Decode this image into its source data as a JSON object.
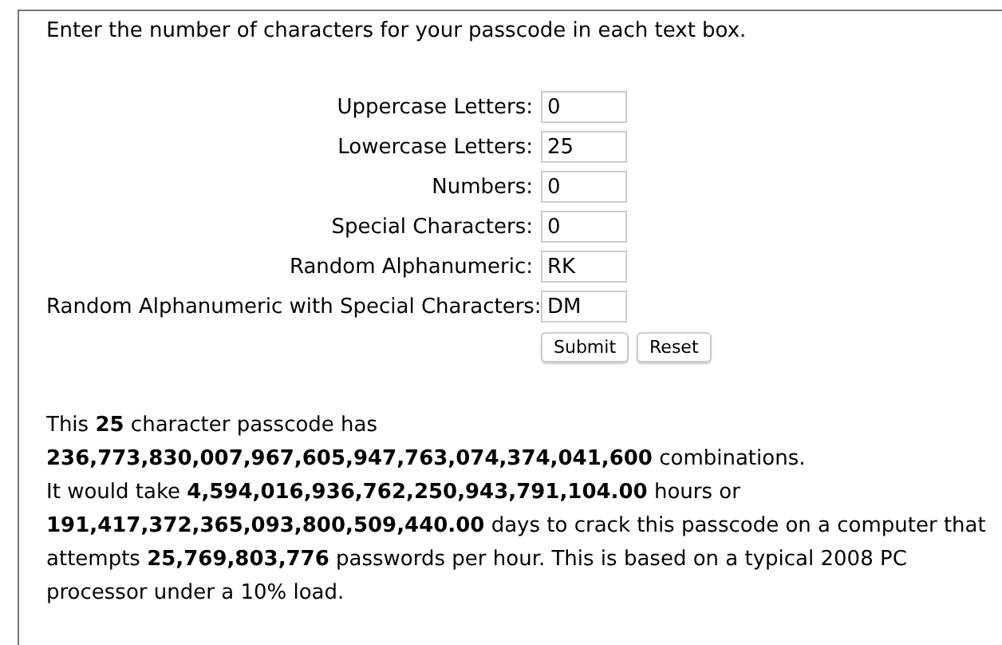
{
  "instructions": "Enter the number of characters for your passcode in each text box.",
  "fields": [
    {
      "label": "Uppercase Letters:",
      "value": "0"
    },
    {
      "label": "Lowercase Letters:",
      "value": "25"
    },
    {
      "label": "Numbers:",
      "value": "0"
    },
    {
      "label": "Special Characters:",
      "value": "0"
    },
    {
      "label": "Random Alphanumeric:",
      "value": "RK"
    },
    {
      "label": "Random Alphanumeric with Special Characters:",
      "value": "DM"
    }
  ],
  "buttons": [
    "Submit",
    "Reset"
  ],
  "result": [
    "This **25** character passcode has **236,773,830,007,967,605,947,763,074,374,041,600** combinations.",
    "It would take **4,594,016,936,762,250,943,791,104.00** hours or **191,417,372,365,093,800,509,440.00** days to crack this passcode on a computer that attempts **25,769,803,776** passwords per hour. This is based on a typical 2008 PC processor under a 10% load."
  ]
}
